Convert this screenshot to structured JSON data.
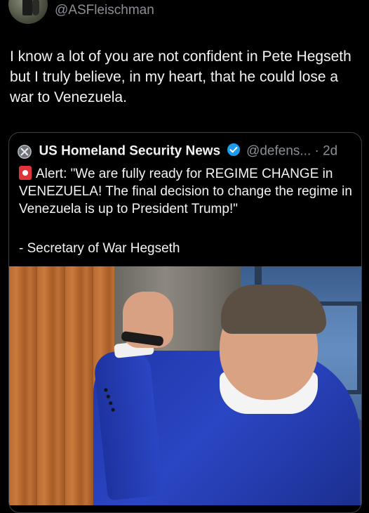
{
  "header": {
    "handle": "@ASFleischman"
  },
  "tweet": {
    "text": "I know a lot of you are not confident in Pete Hegseth but I truly believe, in my heart, that he could lose a war to Venezuela."
  },
  "quote": {
    "name": "US Homeland Security News",
    "handle_time": "@defens... · 2d",
    "body": "Alert: \"We are fully ready for REGIME CHANGE in VENEZUELA! The final decision to change the regime in Venezuela is up to President Trump!\"",
    "signature": "- Secretary of War Hegseth"
  },
  "colors": {
    "background": "#000000",
    "verified": "#1d9bf0",
    "muted": "#8b8f94"
  },
  "icons": {
    "avatar": "avatar",
    "dhs": "dhs-seal-icon",
    "verified": "verified-badge-icon",
    "alert": "siren-icon"
  }
}
